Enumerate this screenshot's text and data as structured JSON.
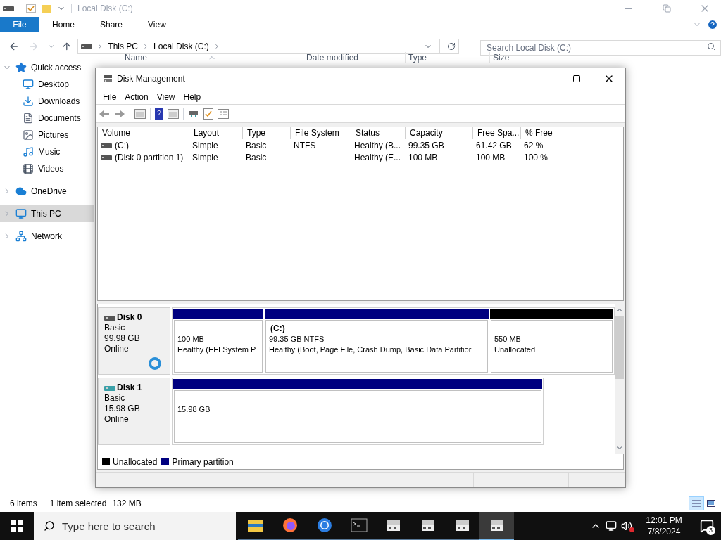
{
  "explorer": {
    "title": "Local Disk (C:)",
    "ribbon_tabs": [
      {
        "label": "File",
        "selected": true
      },
      {
        "label": "Home",
        "selected": false
      },
      {
        "label": "Share",
        "selected": false
      },
      {
        "label": "View",
        "selected": false
      }
    ],
    "breadcrumb": [
      "This PC",
      "Local Disk (C:)"
    ],
    "search": {
      "placeholder": "Search Local Disk (C:)"
    },
    "columns": [
      "Name",
      "Date modified",
      "Type",
      "Size"
    ],
    "sidebar": [
      {
        "label": "Quick access",
        "kind": "star",
        "expanded": true,
        "selected": false,
        "children": [
          {
            "label": "Desktop",
            "kind": "desktop",
            "selected": false
          },
          {
            "label": "Downloads",
            "kind": "download",
            "selected": false
          },
          {
            "label": "Documents",
            "kind": "document",
            "selected": false
          },
          {
            "label": "Pictures",
            "kind": "pictures",
            "selected": false
          },
          {
            "label": "Music",
            "kind": "music",
            "selected": false
          },
          {
            "label": "Videos",
            "kind": "video",
            "selected": false
          }
        ]
      },
      {
        "label": "OneDrive",
        "kind": "cloud",
        "expanded": false,
        "selected": false
      },
      {
        "label": "This PC",
        "kind": "pc",
        "expanded": false,
        "selected": true
      },
      {
        "label": "Network",
        "kind": "network",
        "expanded": false,
        "selected": false
      }
    ],
    "status_bar": {
      "items": "6 items",
      "selection": "1 item selected",
      "size": "132 MB"
    }
  },
  "disk_management": {
    "title": "Disk Management",
    "menu": [
      "File",
      "Action",
      "View",
      "Help"
    ],
    "columns": [
      "Volume",
      "Layout",
      "Type",
      "File System",
      "Status",
      "Capacity",
      "Free Spa...",
      "% Free"
    ],
    "rows": [
      {
        "cells": [
          "(C:)",
          "Simple",
          "Basic",
          "NTFS",
          "Healthy (B...",
          "99.35 GB",
          "61.42 GB",
          "62 %"
        ]
      },
      {
        "cells": [
          "(Disk 0 partition 1)",
          "Simple",
          "Basic",
          "",
          "Healthy (E...",
          "100 MB",
          "100 MB",
          "100 %"
        ]
      }
    ],
    "disks": [
      {
        "name": "Disk 0",
        "type": "Basic",
        "size": "99.98 GB",
        "status": "Online",
        "partitions": [
          {
            "kind": "primary",
            "lines": [
              "100 MB",
              "Healthy (EFI System P"
            ]
          },
          {
            "kind": "primary",
            "title": "(C:)",
            "lines": [
              "99.35 GB NTFS",
              "Healthy (Boot, Page File, Crash Dump, Basic Data Partitior"
            ]
          },
          {
            "kind": "unallocated",
            "lines": [
              "550 MB",
              "Unallocated"
            ]
          }
        ]
      },
      {
        "name": "Disk 1",
        "type": "Basic",
        "size": "15.98 GB",
        "status": "Online",
        "partitions": [
          {
            "kind": "primary",
            "lines": [
              "15.98 GB"
            ]
          }
        ]
      }
    ],
    "legend": [
      {
        "label": "Unallocated",
        "color": "#000000"
      },
      {
        "label": "Primary partition",
        "color": "#000080"
      }
    ]
  },
  "taskbar": {
    "search": {
      "placeholder": "Type here to search"
    },
    "apps": [
      {
        "kind": "folder",
        "selected": false
      },
      {
        "kind": "firefox",
        "selected": false
      },
      {
        "kind": "chrome",
        "selected": false
      },
      {
        "kind": "terminal",
        "selected": false
      },
      {
        "kind": "disk",
        "selected": false
      },
      {
        "kind": "disk",
        "selected": false
      },
      {
        "kind": "disk",
        "selected": false
      },
      {
        "kind": "disk",
        "selected": true
      }
    ],
    "time": "12:01 PM",
    "date": "7/8/2024",
    "notifications": "3"
  }
}
